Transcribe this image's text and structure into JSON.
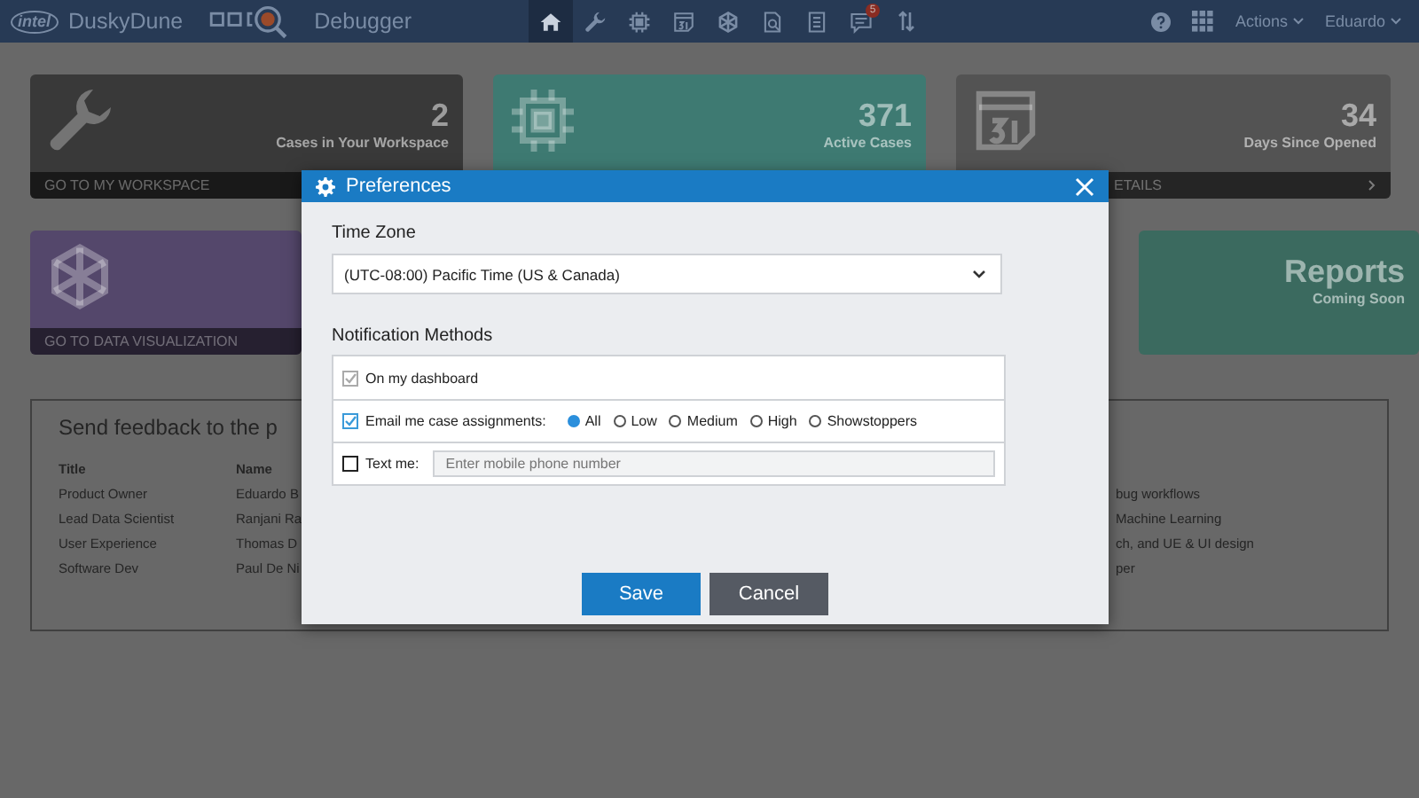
{
  "header": {
    "brand": "intel",
    "app_name": "DuskyDune",
    "app_suffix": "Debugger",
    "nav": [
      {
        "kind": "home",
        "selected": true
      },
      {
        "kind": "wrench",
        "selected": false
      },
      {
        "kind": "chip",
        "selected": false
      },
      {
        "kind": "calendar",
        "selected": false
      },
      {
        "kind": "network",
        "selected": false
      },
      {
        "kind": "search-doc",
        "selected": false
      },
      {
        "kind": "document",
        "selected": false
      },
      {
        "kind": "chat",
        "selected": false,
        "badge": "5"
      }
    ],
    "menus": [
      "Actions",
      "Eduardo"
    ]
  },
  "cards": [
    {
      "kind": "wrench",
      "color": "#393939",
      "value": "2",
      "label": "Cases in Your Workspace",
      "footer": "GO TO MY WORKSPACE"
    },
    {
      "kind": "chip",
      "color": "#3e7a72",
      "value": "371",
      "label": "Active Cases"
    },
    {
      "kind": "calendar",
      "color": "#535353",
      "value": "34",
      "label": "Days Since Opened",
      "footer": "ETAILS"
    },
    {
      "kind": "network",
      "color": "#54476b",
      "footer": "GO TO DATA VISUALIZATION"
    },
    {
      "kind": "none",
      "color": "#3b6a5f",
      "value": "Reports",
      "label": "Coming Soon"
    }
  ],
  "feedback": {
    "title": "Send feedback to the p",
    "columns": [
      "Title",
      "Name"
    ],
    "rows": [
      [
        "Product Owner",
        "Eduardo B",
        "bug workflows"
      ],
      [
        "Lead Data Scientist",
        "Ranjani Ra",
        "Machine Learning"
      ],
      [
        "User Experience",
        "Thomas D",
        "ch, and UE & UI design"
      ],
      [
        "Software Dev",
        "Paul De Ni",
        "per"
      ]
    ]
  },
  "dialog": {
    "title": "Preferences",
    "timezone_label": "Time Zone",
    "timezone": "(UTC-08:00) Pacific Time (US & Canada)",
    "notifications_label": "Notification Methods",
    "methods": [
      {
        "kind": "plain",
        "label": "On my dashboard",
        "checked": true,
        "disabled": true
      },
      {
        "kind": "levels",
        "label": "Email me case assignments:",
        "checked": true,
        "disabled": false,
        "options": [
          {
            "label": "All",
            "selected": true
          },
          {
            "label": "Low",
            "selected": false
          },
          {
            "label": "Medium",
            "selected": false
          },
          {
            "label": "High",
            "selected": false
          },
          {
            "label": "Showstoppers",
            "selected": false
          }
        ]
      },
      {
        "kind": "phone",
        "label": "Text me:",
        "checked": false,
        "disabled": false,
        "placeholder": "Enter mobile phone number"
      }
    ],
    "buttons": [
      {
        "kind": "primary",
        "label": "Save"
      },
      {
        "kind": "secondary",
        "label": "Cancel"
      }
    ]
  }
}
